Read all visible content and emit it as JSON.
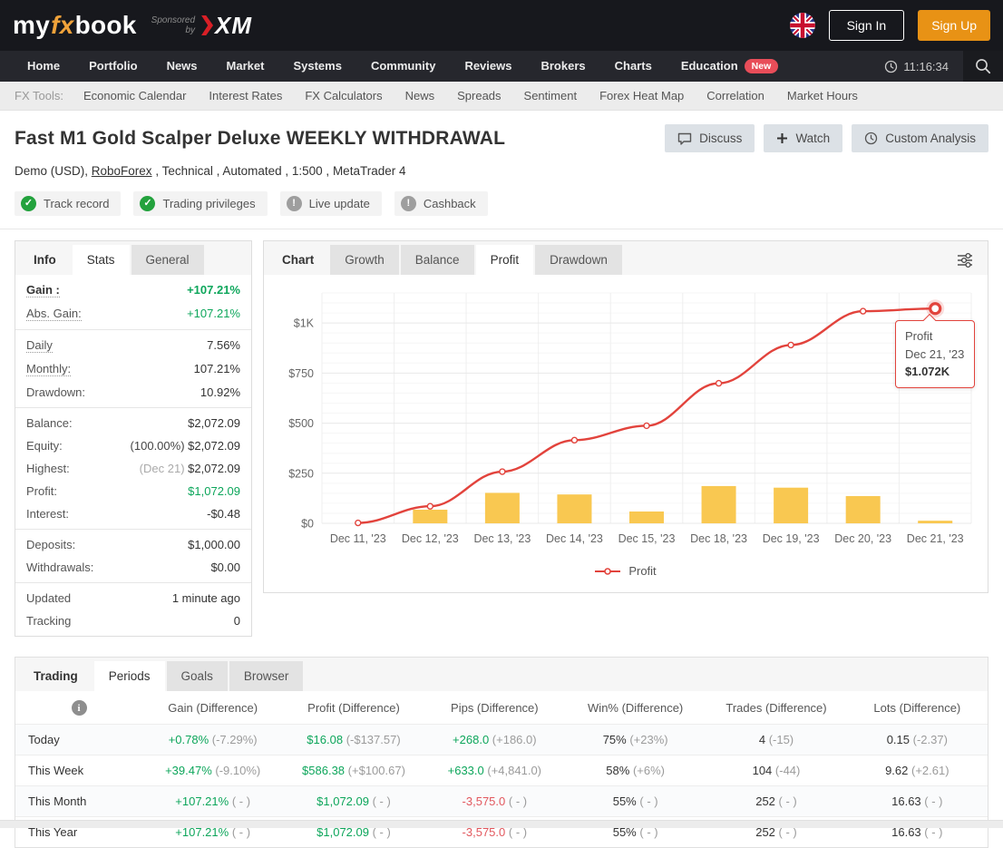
{
  "colors": {
    "green": "#0da65b",
    "red": "#e2575d",
    "line_red": "#e2433c",
    "bar_yellow": "#f9c851",
    "signup_orange": "#e89215",
    "new_badge": "#e84d59"
  },
  "header": {
    "logo_part1": "my",
    "logo_part2": "fx",
    "logo_part3": "book",
    "sponsored_line1": "Sponsored",
    "sponsored_line2": "by",
    "xm_text": "XM",
    "sign_in": "Sign In",
    "sign_up": "Sign Up"
  },
  "nav": {
    "items": [
      "Home",
      "Portfolio",
      "News",
      "Market",
      "Systems",
      "Community",
      "Reviews",
      "Brokers",
      "Charts",
      "Education"
    ],
    "new_badge": "New",
    "time": "11:16:34"
  },
  "fxtools": {
    "label": "FX Tools:",
    "items": [
      "Economic Calendar",
      "Interest Rates",
      "FX Calculators",
      "News",
      "Spreads",
      "Sentiment",
      "Forex Heat Map",
      "Correlation",
      "Market Hours"
    ]
  },
  "page": {
    "title": "Fast M1 Gold Scalper Deluxe WEEKLY WITHDRAWAL",
    "meta_pre": "Demo (USD), ",
    "meta_link": "RoboForex",
    "meta_post": " , Technical , Automated , 1:500 , MetaTrader 4",
    "actions": [
      {
        "label": "Discuss"
      },
      {
        "label": "Watch"
      },
      {
        "label": "Custom Analysis"
      }
    ],
    "badges": [
      {
        "label": "Track record",
        "state": "ok"
      },
      {
        "label": "Trading privileges",
        "state": "ok"
      },
      {
        "label": "Live update",
        "state": "info"
      },
      {
        "label": "Cashback",
        "state": "info"
      }
    ]
  },
  "stats": {
    "tabs": [
      "Info",
      "Stats",
      "General"
    ],
    "active_tab": "Stats",
    "groups": [
      {
        "rows": [
          {
            "label": "Gain :",
            "value": "+107.21%"
          },
          {
            "label": "Abs. Gain:",
            "value": "+107.21%"
          }
        ]
      },
      {
        "rows": [
          {
            "label": "Daily",
            "value": "7.56%"
          },
          {
            "label": "Monthly:",
            "value": "107.21%"
          },
          {
            "label": "Drawdown:",
            "value": "10.92%"
          }
        ]
      },
      {
        "rows": [
          {
            "label": "Balance:",
            "value": "$2,072.09"
          },
          {
            "label": "Equity:",
            "prefix": "(100.00%)",
            "value": "$2,072.09"
          },
          {
            "label": "Highest:",
            "prefix": "(Dec 21)",
            "value": "$2,072.09"
          },
          {
            "label": "Profit:",
            "value": "$1,072.09"
          },
          {
            "label": "Interest:",
            "value": "-$0.48"
          }
        ]
      },
      {
        "rows": [
          {
            "label": "Deposits:",
            "value": "$1,000.00"
          },
          {
            "label": "Withdrawals:",
            "value": "$0.00"
          }
        ]
      },
      {
        "rows": [
          {
            "label": "Updated",
            "value": "1 minute ago"
          },
          {
            "label": "Tracking",
            "value": "0"
          }
        ]
      }
    ]
  },
  "chart_panel": {
    "tabs": [
      "Chart",
      "Growth",
      "Balance",
      "Profit",
      "Drawdown"
    ],
    "active_tab": "Profit",
    "legend_label": "Profit",
    "tooltip": {
      "title": "Profit",
      "date": "Dec 21, '23",
      "value": "$1.072K"
    },
    "chart_data": {
      "type": "line",
      "x": [
        "Dec 11, '23",
        "Dec 12, '23",
        "Dec 13, '23",
        "Dec 14, '23",
        "Dec 15, '23",
        "Dec 18, '23",
        "Dec 19, '23",
        "Dec 20, '23",
        "Dec 21, '23"
      ],
      "series": [
        {
          "name": "Profit",
          "type": "line",
          "color": "#e2433c",
          "values": [
            2,
            85,
            258,
            415,
            487,
            699,
            890,
            1059,
            1072
          ]
        },
        {
          "name": "Daily profit",
          "type": "bar",
          "color": "#f9c851",
          "values": [
            0,
            68,
            152,
            144,
            59,
            186,
            178,
            136,
            13
          ]
        }
      ],
      "yticks": [
        {
          "v": 0,
          "label": "$0"
        },
        {
          "v": 250,
          "label": "$250"
        },
        {
          "v": 500,
          "label": "$500"
        },
        {
          "v": 750,
          "label": "$750"
        },
        {
          "v": 1000,
          "label": "$1K"
        }
      ],
      "ylim": [
        0,
        1150
      ],
      "grid": true,
      "legend_position": "bottom"
    }
  },
  "periods": {
    "tabs": [
      "Trading",
      "Periods",
      "Goals",
      "Browser"
    ],
    "active_tab": "Periods",
    "headers": [
      "Gain (Difference)",
      "Profit (Difference)",
      "Pips (Difference)",
      "Win% (Difference)",
      "Trades (Difference)",
      "Lots (Difference)"
    ],
    "rows": [
      {
        "label": "Today",
        "cells": [
          {
            "main": "+0.78%",
            "tone": "pos",
            "diff": "(-7.29%)"
          },
          {
            "main": "$16.08",
            "tone": "pos",
            "diff": "(-$137.57)"
          },
          {
            "main": "+268.0",
            "tone": "pos",
            "diff": "(+186.0)"
          },
          {
            "main": "75%",
            "tone": "plain",
            "diff": "(+23%)"
          },
          {
            "main": "4",
            "tone": "plain",
            "diff": "(-15)"
          },
          {
            "main": "0.15",
            "tone": "plain",
            "diff": "(-2.37)"
          }
        ]
      },
      {
        "label": "This Week",
        "cells": [
          {
            "main": "+39.47%",
            "tone": "pos",
            "diff": "(-9.10%)"
          },
          {
            "main": "$586.38",
            "tone": "pos",
            "diff": "(+$100.67)"
          },
          {
            "main": "+633.0",
            "tone": "pos",
            "diff": "(+4,841.0)"
          },
          {
            "main": "58%",
            "tone": "plain",
            "diff": "(+6%)"
          },
          {
            "main": "104",
            "tone": "plain",
            "diff": "(-44)"
          },
          {
            "main": "9.62",
            "tone": "plain",
            "diff": "(+2.61)"
          }
        ]
      },
      {
        "label": "This Month",
        "cells": [
          {
            "main": "+107.21%",
            "tone": "pos",
            "diff": "( - )"
          },
          {
            "main": "$1,072.09",
            "tone": "pos",
            "diff": "( - )"
          },
          {
            "main": "-3,575.0",
            "tone": "neg",
            "diff": "( - )"
          },
          {
            "main": "55%",
            "tone": "plain",
            "diff": "( - )"
          },
          {
            "main": "252",
            "tone": "plain",
            "diff": "( - )"
          },
          {
            "main": "16.63",
            "tone": "plain",
            "diff": "( - )"
          }
        ]
      },
      {
        "label": "This Year",
        "cells": [
          {
            "main": "+107.21%",
            "tone": "pos",
            "diff": "( - )"
          },
          {
            "main": "$1,072.09",
            "tone": "pos",
            "diff": "( - )"
          },
          {
            "main": "-3,575.0",
            "tone": "neg",
            "diff": "( - )"
          },
          {
            "main": "55%",
            "tone": "plain",
            "diff": "( - )"
          },
          {
            "main": "252",
            "tone": "plain",
            "diff": "( - )"
          },
          {
            "main": "16.63",
            "tone": "plain",
            "diff": "( - )"
          }
        ]
      }
    ]
  }
}
